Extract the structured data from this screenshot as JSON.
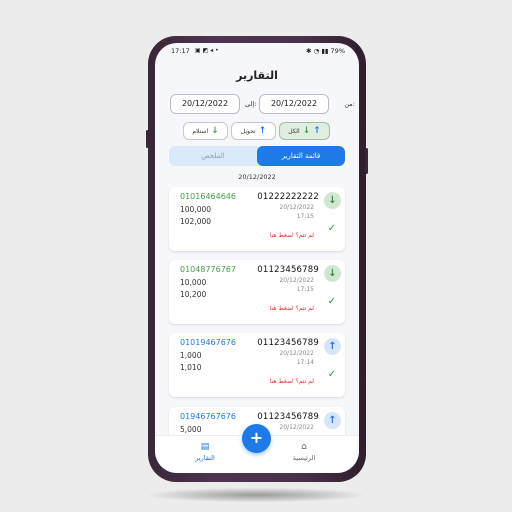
{
  "status_bar": {
    "time": "17:17",
    "battery": "79%"
  },
  "header": {
    "title": "التقارير"
  },
  "filters": {
    "from_label": "من:",
    "to_label": "إلى:",
    "from_date": "20/12/2022",
    "to_date": "20/12/2022"
  },
  "chips": {
    "all": "الكل",
    "transfer": "تحويل",
    "receive": "استلام"
  },
  "tabs": {
    "reports_list": "قائمة التقارير",
    "summary": "الملخص"
  },
  "list": {
    "date_header": "20/12/2022",
    "items": [
      {
        "number": "01222222222",
        "date": "20/12/2022",
        "time": "17:15",
        "phone": "01016464646",
        "amount": "100,000",
        "total": "102,000",
        "retry": "لم تتم؟ اضغط هنا",
        "direction": "in"
      },
      {
        "number": "01123456789",
        "date": "20/12/2022",
        "time": "17:15",
        "phone": "01048776767",
        "amount": "10,000",
        "total": "10,200",
        "retry": "لم تتم؟ اضغط هنا",
        "direction": "in"
      },
      {
        "number": "01123456789",
        "date": "20/12/2022",
        "time": "17:14",
        "phone": "01019467676",
        "amount": "1,000",
        "total": "1,010",
        "retry": "لم تتم؟ اضغط هنا",
        "direction": "out"
      },
      {
        "number": "01123456789",
        "date": "20/12/2022",
        "phone": "01946767676",
        "amount": "5,000",
        "direction": "out"
      }
    ]
  },
  "bottom_nav": {
    "reports": "التقارير",
    "home": "الرئيسية"
  },
  "colors": {
    "accent": "#1e7ae6",
    "incoming": "#43a047",
    "error": "#e03030"
  }
}
